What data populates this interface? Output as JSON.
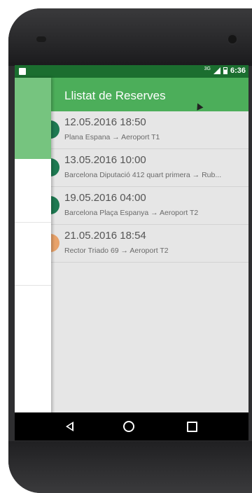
{
  "app": {
    "title": "Llistat de Reserves"
  },
  "status_bar": {
    "network": "3G",
    "time": "6:36"
  },
  "reservations": [
    {
      "datetime": "12.05.2016  18:50",
      "route": "Plana Espana → Aeroport T1",
      "color": "#1e7a52"
    },
    {
      "datetime": "13.05.2016  10:00",
      "route": "Barcelona Diputació 412 quart primera → Rub...",
      "color": "#1e7a52"
    },
    {
      "datetime": "19.05.2016  04:00",
      "route": "Barcelona Plaça Espanya → Aeroport T2",
      "color": "#1e7a52"
    },
    {
      "datetime": "21.05.2016  18:54",
      "route": "Rector Triado 69 → Aeroport T2",
      "color": "#e8a26a"
    }
  ],
  "theme": {
    "primary": "#4cae5a",
    "primary_dark": "#1b6e2f",
    "drawer_header": "#76c47f"
  }
}
